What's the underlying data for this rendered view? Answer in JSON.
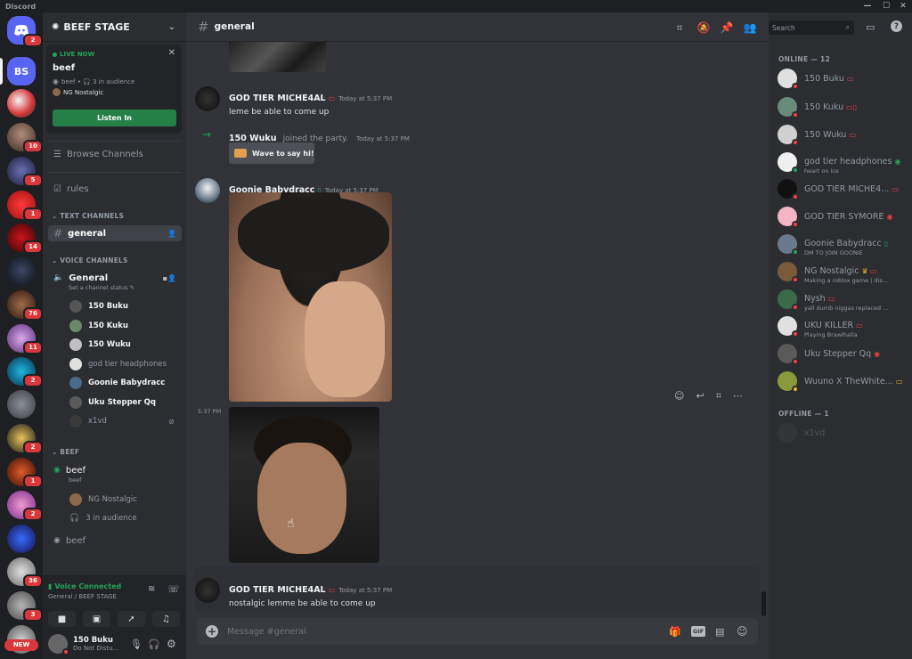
{
  "app": {
    "title": "Discord"
  },
  "server": {
    "name": "BEEF STAGE"
  },
  "guild_badges": [
    "2",
    "10",
    "5",
    "1",
    "14",
    "76",
    "11",
    "2",
    "2",
    "1",
    "2",
    "36",
    "3",
    "NEW"
  ],
  "stage": {
    "live_label": "LIVE NOW",
    "name": "beef",
    "meta": "beef • 🎧 3 in audience",
    "speaker": "NG Nostalgic",
    "listen_button": "Listen In"
  },
  "nav": {
    "browse_channels": "Browse Channels",
    "rules": "rules"
  },
  "categories": {
    "text": "TEXT CHANNELS",
    "voice": "VOICE CHANNELS",
    "beef": "BEEF"
  },
  "text_channels": {
    "general": "general"
  },
  "voice": {
    "channel_name": "General",
    "channel_status": "Set a channel status",
    "users": [
      "150 Buku",
      "150 Kuku",
      "150 Wuku",
      "god tier headphones",
      "Goonie Babydracc",
      "Uku Stepper Qq",
      "x1vd"
    ]
  },
  "beef_stage": {
    "name": "beef",
    "topic": "beef",
    "speaker": "NG Nostalgic",
    "audience": "3 in audience",
    "second": "beef"
  },
  "voice_connected": {
    "title": "Voice Connected",
    "sub": "General / BEEF STAGE"
  },
  "user_panel": {
    "name": "150 Buku",
    "status": "Do Not Distu..."
  },
  "chat": {
    "channel": "general",
    "search_placeholder": "Search",
    "messages": [
      {
        "author": "GOD TIER MICHE4AL",
        "time": "Today at 5:37 PM",
        "text": "leme be able to come up"
      },
      {
        "system": "150 Wuku",
        "system_text": "joined the party.",
        "time": "Today at 5:37 PM",
        "wave": "Wave to say hi!"
      },
      {
        "author": "Goonie Babydracc",
        "time": "Today at 5:37 PM",
        "side_time": "5:37 PM"
      },
      {
        "author": "GOD TIER MICHE4AL",
        "time": "Today at 5:37 PM",
        "text": "nostalgic lemme be able to come up"
      }
    ],
    "composer_placeholder": "Message #general",
    "gif_label": "GIF"
  },
  "members": {
    "online_header": "ONLINE — 12",
    "online": [
      {
        "name": "150 Buku",
        "sub": "",
        "color": "#949ba4"
      },
      {
        "name": "150 Kuku",
        "sub": "",
        "color": "#949ba4"
      },
      {
        "name": "150 Wuku",
        "sub": "",
        "color": "#949ba4"
      },
      {
        "name": "god tier headphones",
        "sub": "heart on ice",
        "color": "#949ba4"
      },
      {
        "name": "GOD TIER MICHE4...",
        "sub": "",
        "color": "#949ba4"
      },
      {
        "name": "GOD TIER SYMORE",
        "sub": "",
        "color": "#949ba4"
      },
      {
        "name": "Goonie Babydracc",
        "sub": "DM TO JOIN GOONIE",
        "color": "#949ba4"
      },
      {
        "name": "NG Nostalgic",
        "sub": "Making a roblox game | dis...",
        "color": "#949ba4"
      },
      {
        "name": "Nysh",
        "sub": "yall dumb niggas replaced ...",
        "color": "#949ba4"
      },
      {
        "name": "UKU KILLER",
        "sub": "Playing Brawlhalla",
        "color": "#949ba4"
      },
      {
        "name": "Uku Stepper Qq",
        "sub": "",
        "color": "#949ba4"
      },
      {
        "name": "Wuuno X TheWhite...",
        "sub": "",
        "color": "#949ba4"
      }
    ],
    "offline_header": "OFFLINE — 1",
    "offline": [
      {
        "name": "x1vd"
      }
    ]
  },
  "colors": {
    "accent": "#5865f2",
    "green": "#23a55a",
    "dnd": "#f23f43"
  }
}
